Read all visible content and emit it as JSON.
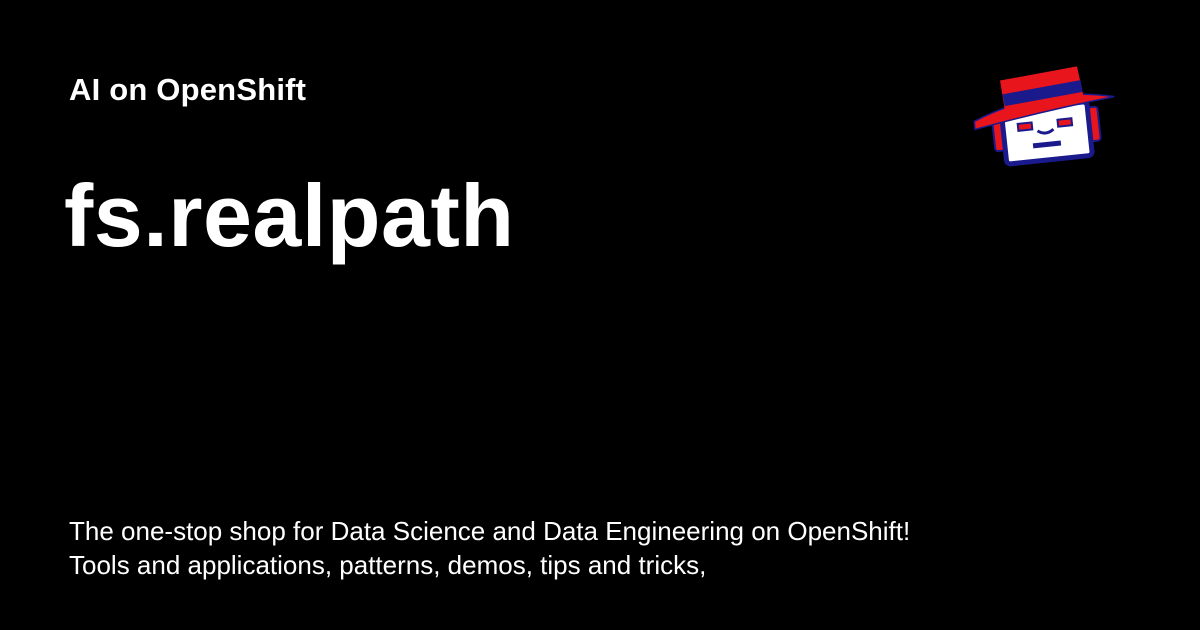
{
  "header": {
    "site_name": "AI on OpenShift"
  },
  "main": {
    "title": "fs.realpath",
    "description": "The one-stop shop for Data Science and Data Engineering on OpenShift! Tools and applications, patterns, demos, tips and tricks,"
  },
  "logo": {
    "icon": "robot-with-red-hat-icon",
    "colors": {
      "hat": "#e8151c",
      "hat_band": "#1a1a8c",
      "face": "#ffffff",
      "outline": "#1a1a8c",
      "eyes": "#e8151c",
      "ears": "#e8151c"
    }
  },
  "colors": {
    "background": "#000000",
    "text": "#ffffff"
  }
}
